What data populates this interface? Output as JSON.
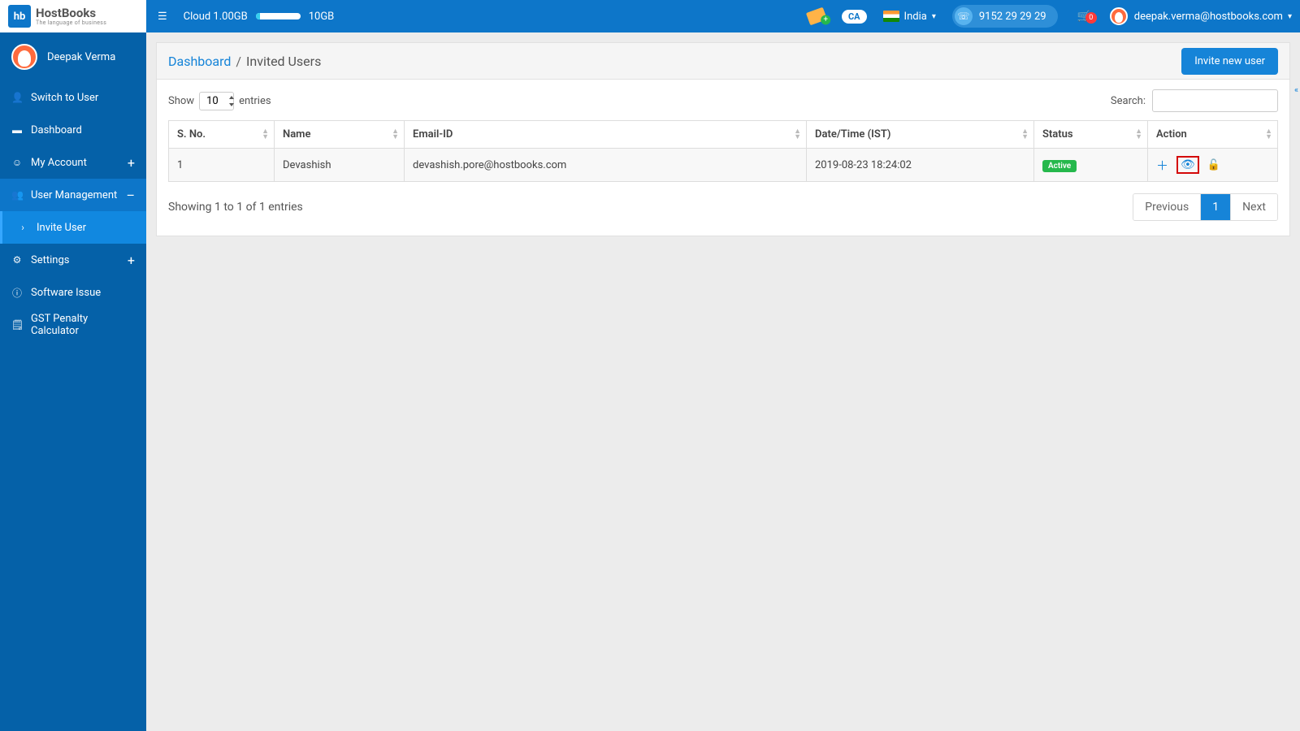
{
  "brand": {
    "code": "hb",
    "name": "HostBooks",
    "tagline": "The language of business"
  },
  "topbar": {
    "cloud_used": "Cloud 1.00GB",
    "cloud_total": "10GB",
    "country": "India",
    "phone": "9152 29 29 29",
    "cart_count": "0",
    "user_email": "deepak.verma@hostbooks.com",
    "ca_badge": "CA"
  },
  "sidebar": {
    "username": "Deepak Verma",
    "items": [
      {
        "icon": "👤",
        "label": "Switch to User"
      },
      {
        "icon": "▬",
        "label": "Dashboard"
      },
      {
        "icon": "☺",
        "label": "My Account",
        "expand": "+"
      },
      {
        "icon": "👥",
        "label": "User Management",
        "expand": "–",
        "selected": true
      },
      {
        "icon": "›",
        "label": "Invite User",
        "sub": true
      },
      {
        "icon": "⚙",
        "label": "Settings",
        "expand": "+"
      },
      {
        "icon": "ⓘ",
        "label": "Software Issue"
      },
      {
        "icon": "🗒",
        "label": "GST Penalty Calculator"
      }
    ]
  },
  "breadcrumb": {
    "root": "Dashboard",
    "sep": "/",
    "current": "Invited Users"
  },
  "buttons": {
    "invite": "Invite new user"
  },
  "table": {
    "show_label_pre": "Show",
    "show_value": "10",
    "show_label_post": "entries",
    "search_label": "Search:",
    "columns": [
      "S. No.",
      "Name",
      "Email-ID",
      "Date/Time (IST)",
      "Status",
      "Action"
    ],
    "rows": [
      {
        "sno": "1",
        "name": "Devashish",
        "email": "devashish.pore@hostbooks.com",
        "datetime": "2019-08-23 18:24:02",
        "status": "Active"
      }
    ],
    "info": "Showing 1 to 1 of 1 entries",
    "pager": {
      "prev": "Previous",
      "pages": [
        "1"
      ],
      "next": "Next"
    }
  }
}
